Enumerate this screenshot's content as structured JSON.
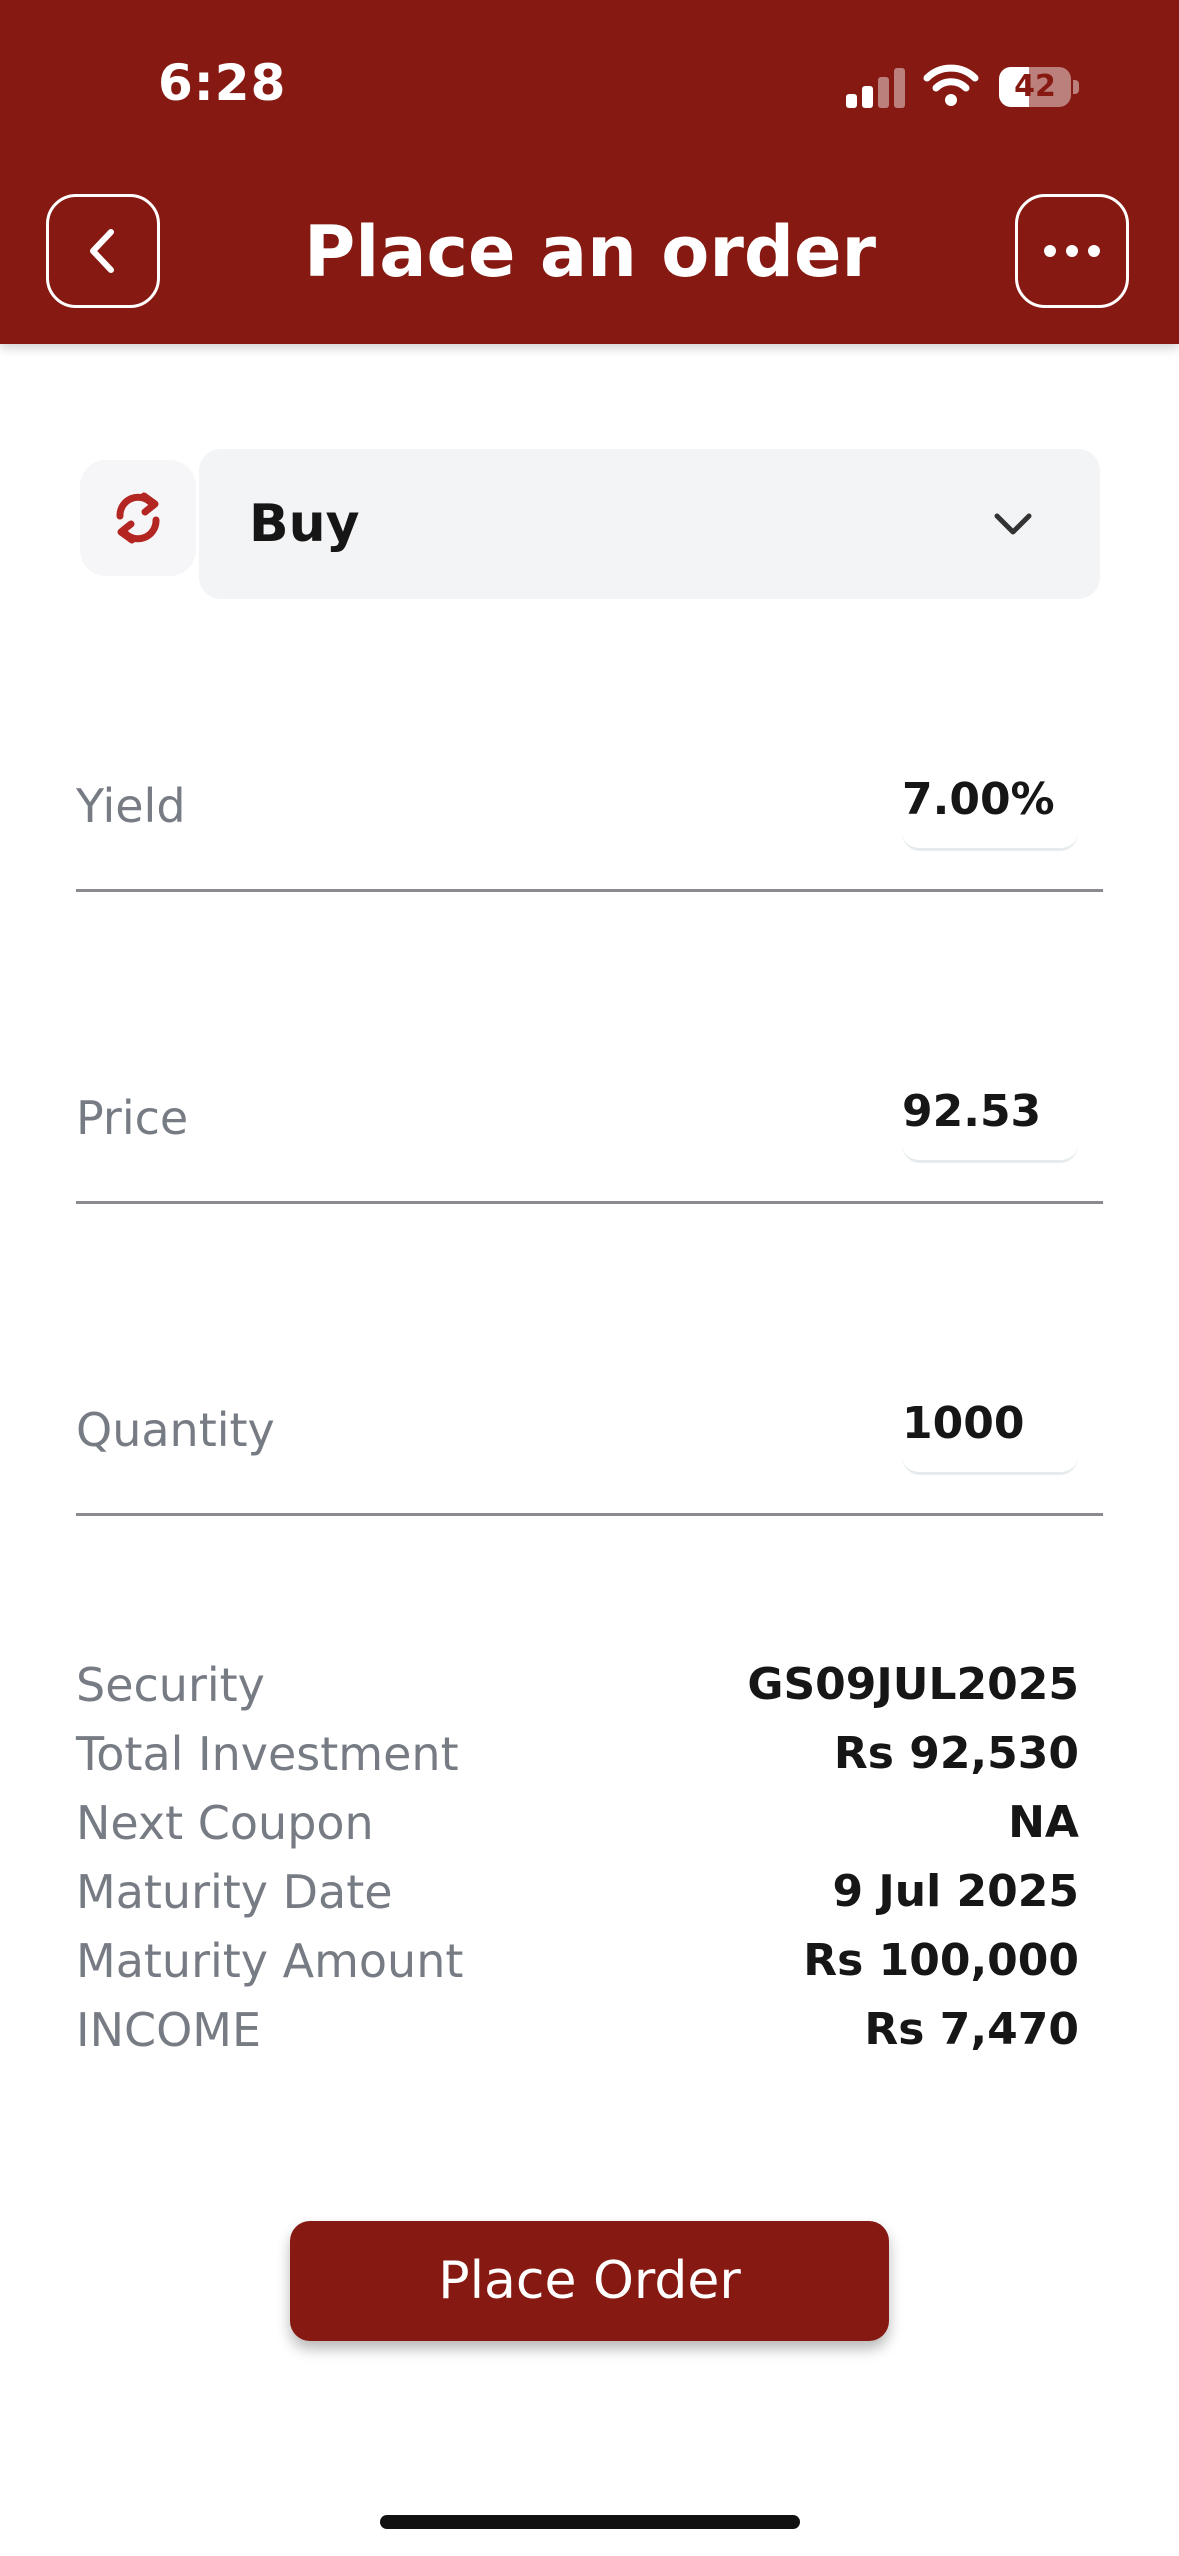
{
  "status_bar": {
    "time": "6:28",
    "battery_text": "42",
    "battery_level_percent": 42
  },
  "header": {
    "title": "Place an order",
    "back_icon": "chevron-left-icon",
    "more_icon": "ellipsis-horizontal-icon",
    "background_color": "#861911"
  },
  "order_side": {
    "selected": "Buy",
    "swap_icon": "refresh-icon",
    "dropdown_icon": "chevron-down-icon",
    "swap_icon_color": "#b32622"
  },
  "fields": {
    "yield": {
      "label": "Yield",
      "value": "7.00%"
    },
    "price": {
      "label": "Price",
      "value": "92.53"
    },
    "quantity": {
      "label": "Quantity",
      "value": "1000"
    }
  },
  "summary": [
    {
      "label": "Security",
      "value": "GS09JUL2025"
    },
    {
      "label": "Total Investment",
      "value": "Rs 92,530"
    },
    {
      "label": "Next Coupon",
      "value": "NA"
    },
    {
      "label": "Maturity Date",
      "value": "9 Jul 2025"
    },
    {
      "label": "Maturity Amount",
      "value": "Rs 100,000"
    },
    {
      "label": "INCOME",
      "value": "Rs 7,470"
    }
  ],
  "actions": {
    "place_order_label": "Place Order",
    "accent_color": "#861911"
  }
}
